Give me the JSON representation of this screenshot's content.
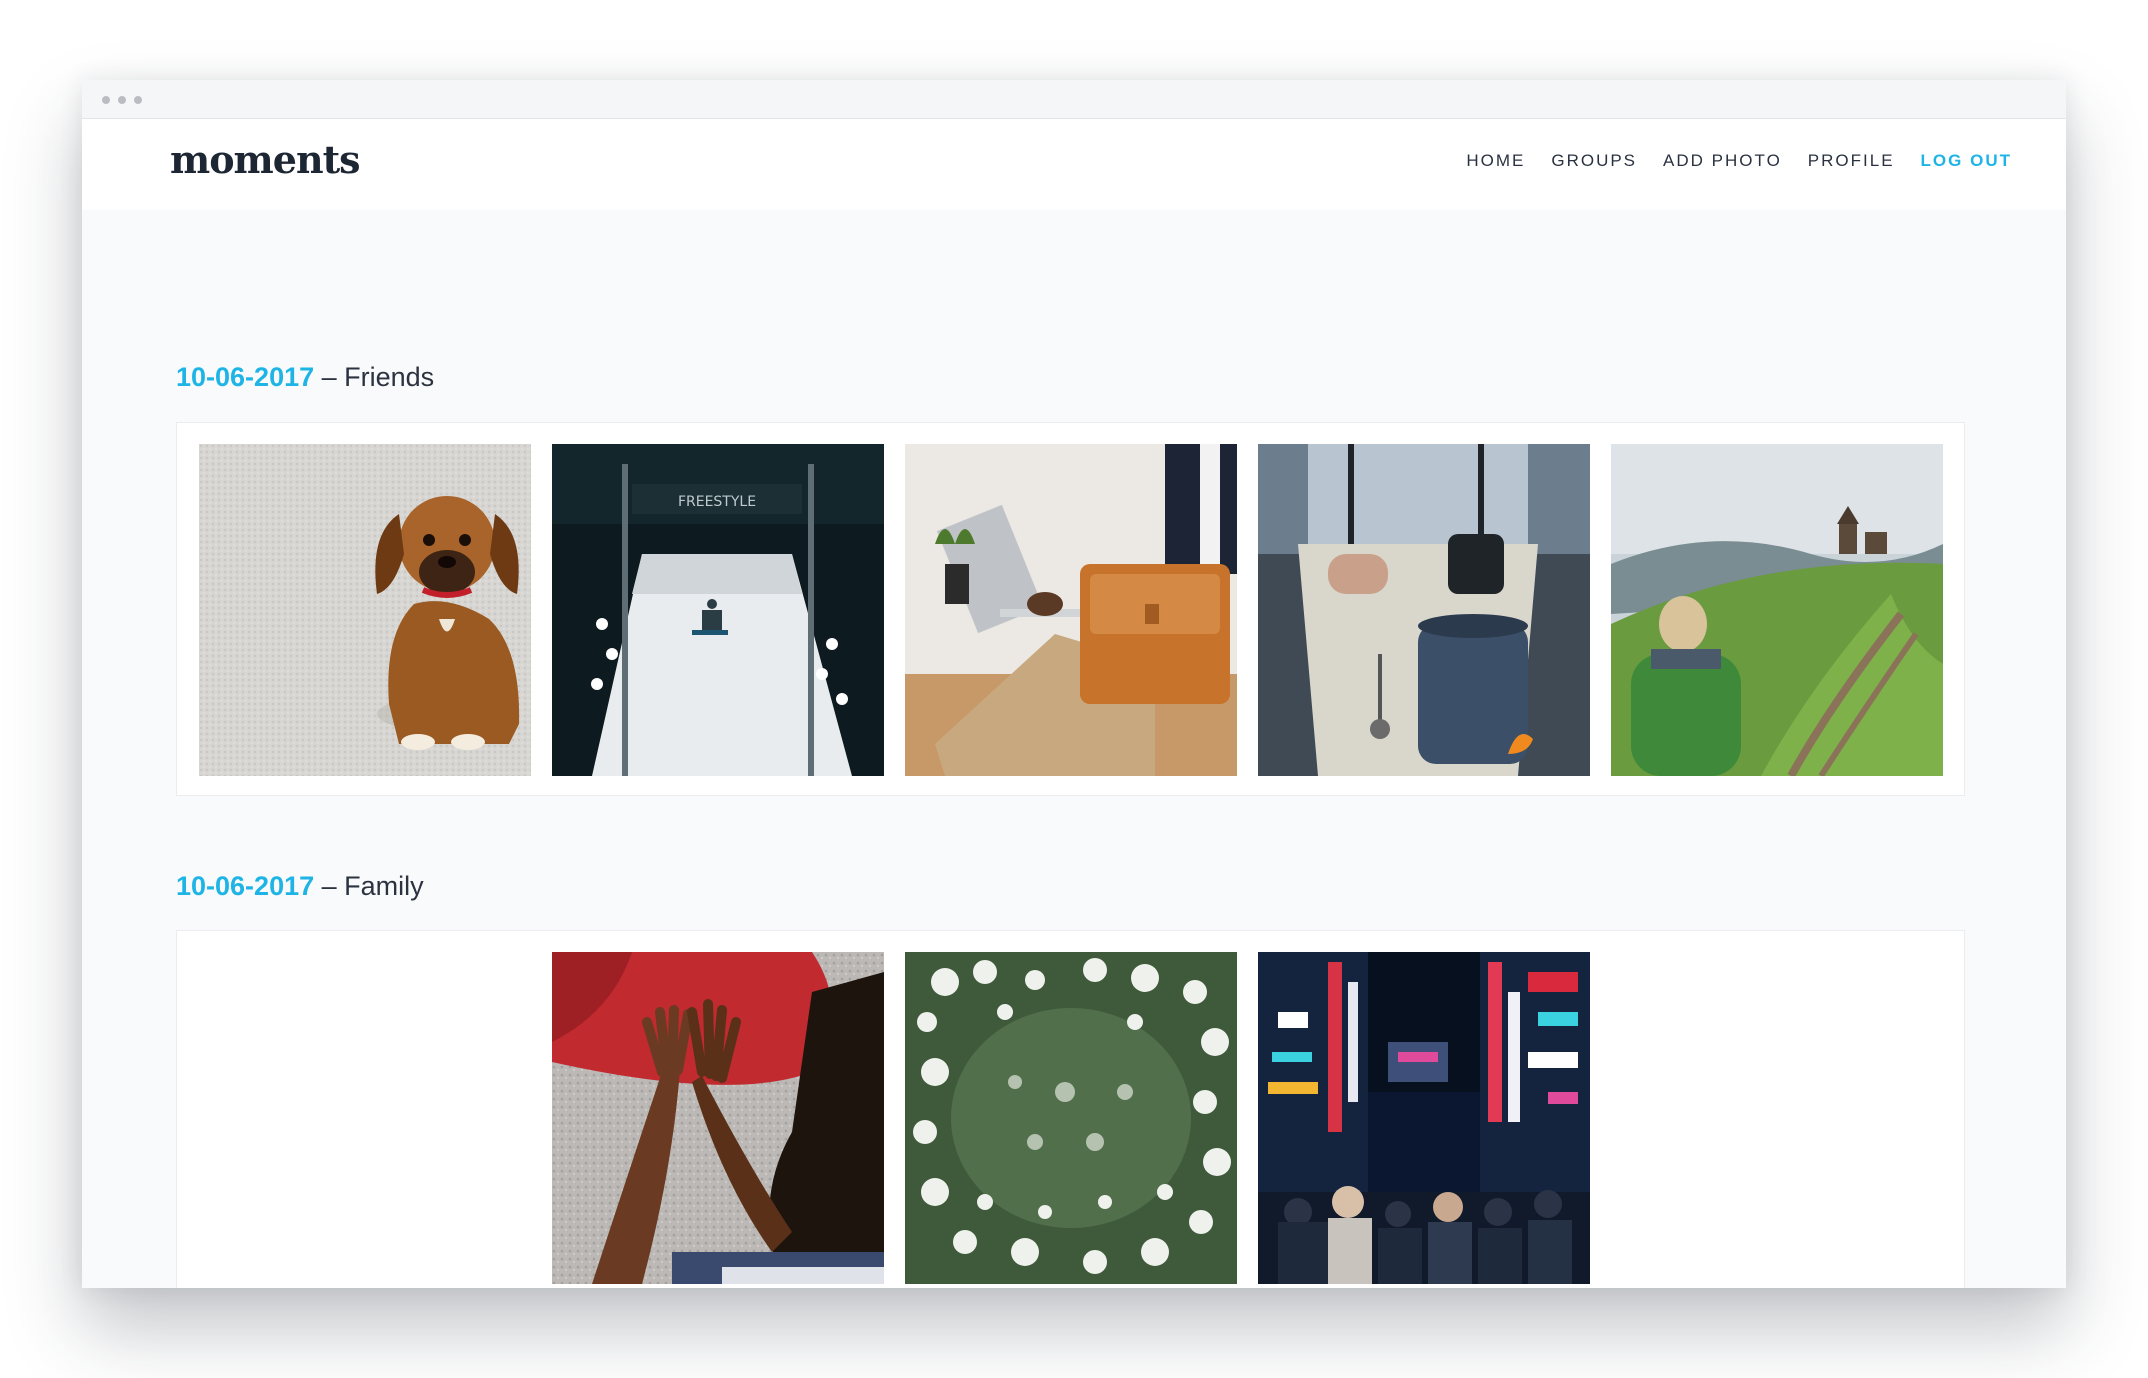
{
  "window": {
    "controls": [
      "dot",
      "dot",
      "dot"
    ]
  },
  "header": {
    "logo": "moments",
    "nav": [
      {
        "label": "HOME"
      },
      {
        "label": "GROUPS"
      },
      {
        "label": "ADD PHOTO"
      },
      {
        "label": "PROFILE"
      },
      {
        "label": "LOG OUT"
      }
    ]
  },
  "colors": {
    "accent": "#1eb4e6",
    "text": "#2b3240",
    "logo": "#1d2633",
    "background": "#f9fafb"
  },
  "sections": [
    {
      "date": "10-06-2017",
      "separator": " – ",
      "group": "Friends",
      "photos": [
        "puppy-photo",
        "snowboard-jump-photo",
        "laptop-bag-photo",
        "coffee-pot-photo",
        "mountain-hiker-photo"
      ]
    },
    {
      "date": "10-06-2017",
      "separator": " – ",
      "group": "Family",
      "photos": [
        "high-five-photo",
        "white-flowers-photo",
        "city-night-photo"
      ]
    }
  ]
}
